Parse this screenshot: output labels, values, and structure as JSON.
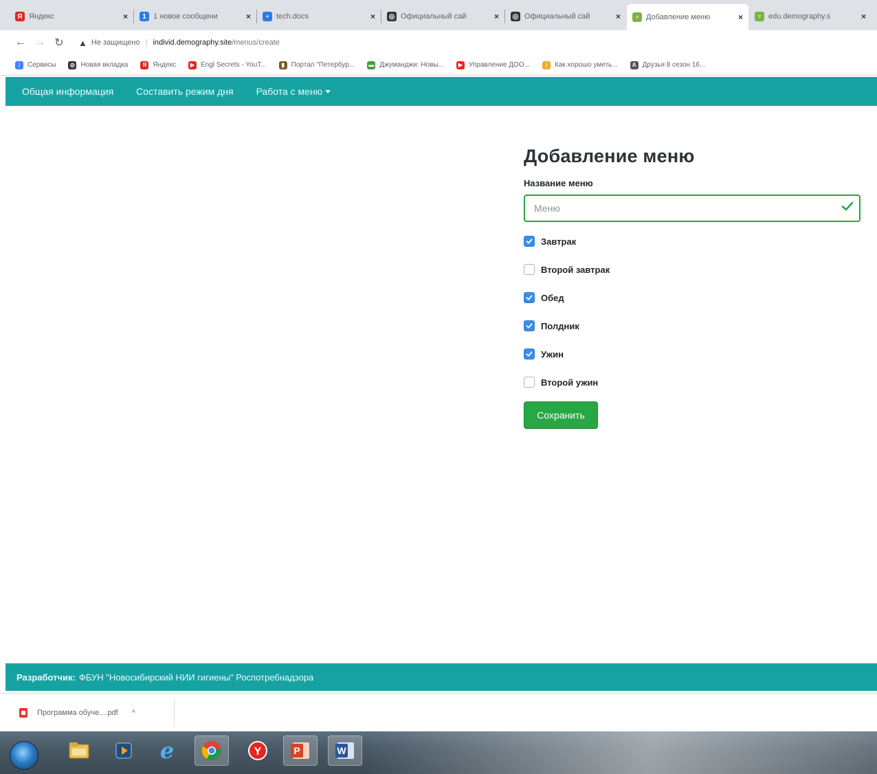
{
  "browser": {
    "tabs": [
      {
        "title": "Яндекс",
        "favicon": "yandex-icon",
        "color": "#e52620",
        "glyph": "Я",
        "active": false
      },
      {
        "title": "1 новое сообщени",
        "favicon": "message-icon",
        "color": "#2d7be5",
        "glyph": "1",
        "active": false
      },
      {
        "title": "tech.docs",
        "favicon": "docs-icon",
        "color": "#2d7be5",
        "glyph": "▪",
        "active": false
      },
      {
        "title": "Официальный сай",
        "favicon": "globe-icon",
        "color": "#333333",
        "glyph": "◎",
        "active": false
      },
      {
        "title": "Официальный сай",
        "favicon": "globe-icon",
        "color": "#333333",
        "glyph": "◎",
        "active": false
      },
      {
        "title": "Добавление меню",
        "favicon": "demography-icon",
        "color": "#7cb342",
        "glyph": "♆",
        "active": true
      },
      {
        "title": "edu.demography.s",
        "favicon": "demography-icon",
        "color": "#7cb342",
        "glyph": "♆",
        "active": false
      }
    ],
    "address": {
      "security_label": "Не защищено",
      "host": "individ.demography.site",
      "path": "/menus/create"
    },
    "bookmarks": [
      {
        "label": "Сервисы",
        "favicon": "apps-grid-icon",
        "color": "#4285f4",
        "glyph": "⋮"
      },
      {
        "label": "Новая вкладка",
        "favicon": "globe-icon",
        "color": "#333333",
        "glyph": "◎"
      },
      {
        "label": "Яндекс",
        "favicon": "yandex-icon",
        "color": "#e52620",
        "glyph": "Я"
      },
      {
        "label": "Engl Secrets - YouT...",
        "favicon": "youtube-icon",
        "color": "#e52620",
        "glyph": "▶"
      },
      {
        "label": "Портал \"Петербур...",
        "favicon": "portal-icon",
        "color": "#7a5c2e",
        "glyph": "▮"
      },
      {
        "label": "Джуманджи: Новы...",
        "favicon": "video-icon",
        "color": "#43a047",
        "glyph": "▬"
      },
      {
        "label": "Управление ДОО...",
        "favicon": "youtube-icon",
        "color": "#e52620",
        "glyph": "▶"
      },
      {
        "label": "Как хорошо уметь...",
        "favicon": "bookmark-icon",
        "color": "#f9a825",
        "glyph": "|"
      },
      {
        "label": "Друзья 8 сезон 16...",
        "favicon": "bookmark-icon",
        "color": "#555555",
        "glyph": "A"
      }
    ]
  },
  "site": {
    "nav": {
      "item1": "Общая информация",
      "item2": "Составить режим дня",
      "item3": "Работа с меню"
    },
    "form": {
      "title": "Добавление меню",
      "name_label": "Название меню",
      "name_placeholder": "Меню",
      "name_value": "",
      "meals": [
        {
          "label": "Завтрак",
          "checked": true
        },
        {
          "label": "Второй завтрак",
          "checked": false
        },
        {
          "label": "Обед",
          "checked": true
        },
        {
          "label": "Полдник",
          "checked": true
        },
        {
          "label": "Ужин",
          "checked": true
        },
        {
          "label": "Второй ужин",
          "checked": false
        }
      ],
      "save_label": "Сохранить"
    },
    "footer": {
      "developer_label": "Разработчик:",
      "developer_value": "ФБУН \"Новосибирский НИИ гигиены\" Роспотребнадзора"
    }
  },
  "downloads": {
    "file_name": "Программа обуче....pdf"
  },
  "colors": {
    "accent": "#17a2a2",
    "success": "#28a745",
    "checkbox_checked": "#3a8ee6"
  }
}
